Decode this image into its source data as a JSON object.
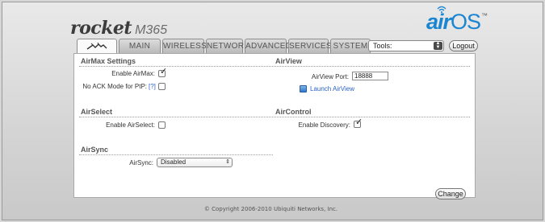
{
  "brand": {
    "name": "rocket",
    "model": "M365"
  },
  "airos": {
    "part1": "air",
    "part2": "OS",
    "tm": "™"
  },
  "tabs": [
    {
      "label": "MAIN"
    },
    {
      "label": "WIRELESS"
    },
    {
      "label": "NETWORK"
    },
    {
      "label": "ADVANCED"
    },
    {
      "label": "SERVICES"
    },
    {
      "label": "SYSTEM"
    }
  ],
  "tools": {
    "value": "Tools:"
  },
  "logout_label": "Logout",
  "airmax": {
    "title": "AirMax Settings",
    "enable_label": "Enable AirMax:",
    "enable_checked": true,
    "noack_label": "No ACK Mode for PtP:",
    "noack_help": "[?]",
    "noack_checked": false
  },
  "airview": {
    "title": "AirView",
    "port_label": "AirView Port:",
    "port_value": "18888",
    "launch_label": "Launch AirView"
  },
  "airselect": {
    "title": "AirSelect",
    "enable_label": "Enable AirSelect:",
    "enable_checked": false
  },
  "aircontrol": {
    "title": "AirControl",
    "discovery_label": "Enable Discovery:",
    "discovery_checked": true
  },
  "airsync": {
    "title": "AirSync",
    "label": "AirSync:",
    "value": "Disabled"
  },
  "change_label": "Change",
  "footer": {
    "copyright": "© Copyright 2006-2010 Ubiquiti Networks, Inc."
  }
}
